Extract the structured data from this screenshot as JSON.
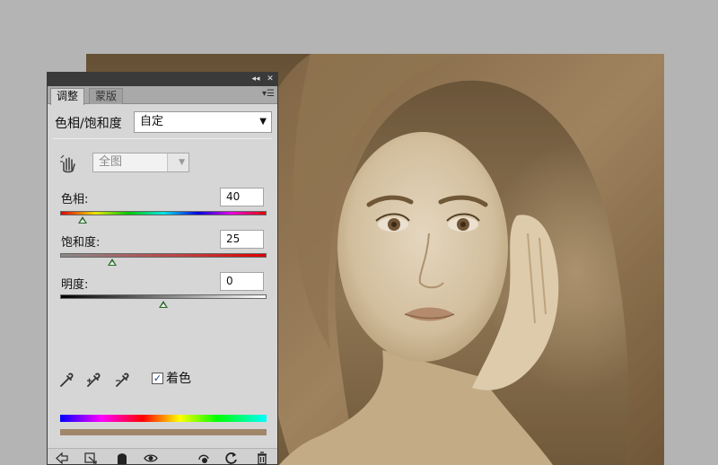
{
  "panel": {
    "collapse_icon": "double-chevron-right-icon",
    "close_icon": "close-icon",
    "tabs": [
      {
        "label": "调整"
      },
      {
        "label": "蒙版"
      }
    ],
    "menu_icon": "panel-menu-icon",
    "adjustment_title": "色相/饱和度",
    "preset": {
      "value": "自定"
    },
    "channel": {
      "value": "全图"
    },
    "sliders": {
      "hue": {
        "label": "色相:",
        "value": "40",
        "fraction": 0.11
      },
      "saturation": {
        "label": "饱和度:",
        "value": "25",
        "fraction": 0.25
      },
      "lightness": {
        "label": "明度:",
        "value": "0",
        "fraction": 0.5
      }
    },
    "colorize": {
      "label": "着色",
      "checked": true,
      "check_glyph": "✓"
    },
    "bottom_icons": [
      "back-arrow-icon",
      "clip-to-layer-icon",
      "visibility-mask-icon",
      "eye-icon",
      "view-previous-state-icon",
      "reset-icon",
      "trash-icon"
    ]
  },
  "colors": {
    "panel_bg": "#d6d6d6",
    "titlebar_bg": "#3a3a3a",
    "sepia_tint": "#a0876a",
    "thumb": "#2b6b2b"
  }
}
